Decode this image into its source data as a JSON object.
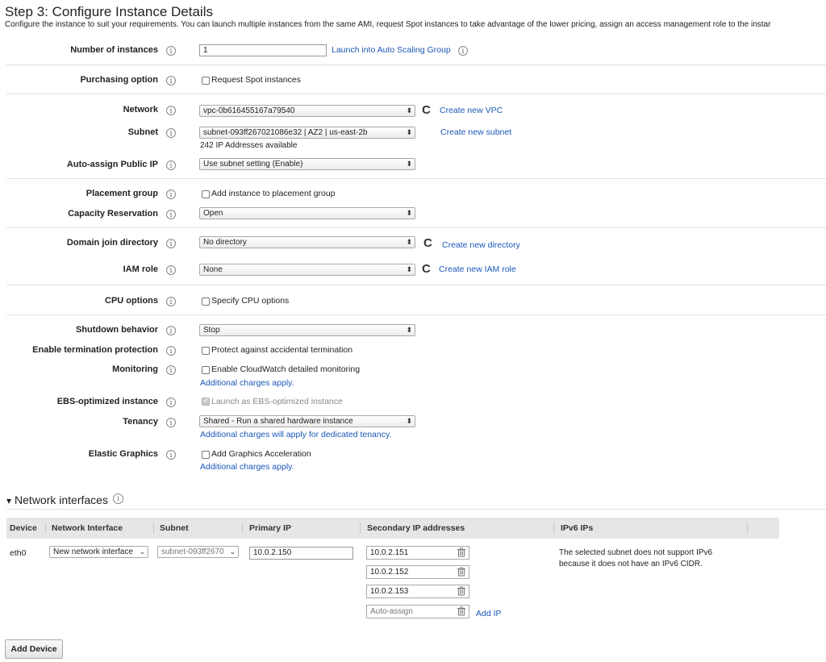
{
  "page": {
    "title": "Step 3: Configure Instance Details",
    "subtitle": "Configure the instance to suit your requirements. You can launch multiple instances from the same AMI, request Spot instances to take advantage of the lower pricing, assign an access management role to the instar"
  },
  "form": {
    "number_of_instances": {
      "label": "Number of instances",
      "value": "1",
      "link": "Launch into Auto Scaling Group"
    },
    "purchasing_option": {
      "label": "Purchasing option",
      "checkbox": "Request Spot instances"
    },
    "network": {
      "label": "Network",
      "value": "vpc-0b616455167a79540",
      "link": "Create new VPC"
    },
    "subnet": {
      "label": "Subnet",
      "value": "subnet-093ff267021086e32 | AZ2 | us-east-2b",
      "note": "242 IP Addresses available",
      "link": "Create new subnet"
    },
    "public_ip": {
      "label": "Auto-assign Public IP",
      "value": "Use subnet setting (Enable)"
    },
    "placement_group": {
      "label": "Placement group",
      "checkbox": "Add instance to placement group"
    },
    "capacity_reservation": {
      "label": "Capacity Reservation",
      "value": "Open"
    },
    "domain_join": {
      "label": "Domain join directory",
      "value": "No directory",
      "link": "Create new directory"
    },
    "iam_role": {
      "label": "IAM role",
      "value": "None",
      "link": "Create new IAM role"
    },
    "cpu_options": {
      "label": "CPU options",
      "checkbox": "Specify CPU options"
    },
    "shutdown": {
      "label": "Shutdown behavior",
      "value": "Stop"
    },
    "termination": {
      "label": "Enable termination protection",
      "checkbox": "Protect against accidental termination"
    },
    "monitoring": {
      "label": "Monitoring",
      "checkbox": "Enable CloudWatch detailed monitoring",
      "note": "Additional charges apply."
    },
    "ebs": {
      "label": "EBS-optimized instance",
      "checkbox": "Launch as EBS-optimized instance"
    },
    "tenancy": {
      "label": "Tenancy",
      "value": "Shared - Run a shared hardware instance",
      "note": "Additional charges will apply for dedicated tenancy."
    },
    "elastic_graphics": {
      "label": "Elastic Graphics",
      "checkbox": "Add Graphics Acceleration",
      "note": "Additional charges apply."
    }
  },
  "network_interfaces": {
    "heading": "Network interfaces",
    "columns": [
      "Device",
      "Network Interface",
      "Subnet",
      "Primary IP",
      "Secondary IP addresses",
      "IPv6 IPs"
    ],
    "row": {
      "device": "eth0",
      "interface": "New network interface",
      "subnet": "subnet-093ff2670",
      "primary_ip": "10.0.2.150",
      "secondary_ips": [
        "10.0.2.151",
        "10.0.2.152",
        "10.0.2.153"
      ],
      "auto_assign_placeholder": "Auto-assign",
      "add_ip": "Add IP",
      "ipv6_note_line1": "The selected subnet does not support IPv6",
      "ipv6_note_line2": "because it does not have an IPv6 CIDR."
    },
    "add_device": "Add Device"
  },
  "icons": {
    "info": "i",
    "refresh": "C",
    "triangle": "▾",
    "select_arrow": "⬍"
  },
  "colors": {
    "link": "#1b58b8",
    "table_header": "#e6e6e6",
    "separator": "#e2e2e2"
  }
}
